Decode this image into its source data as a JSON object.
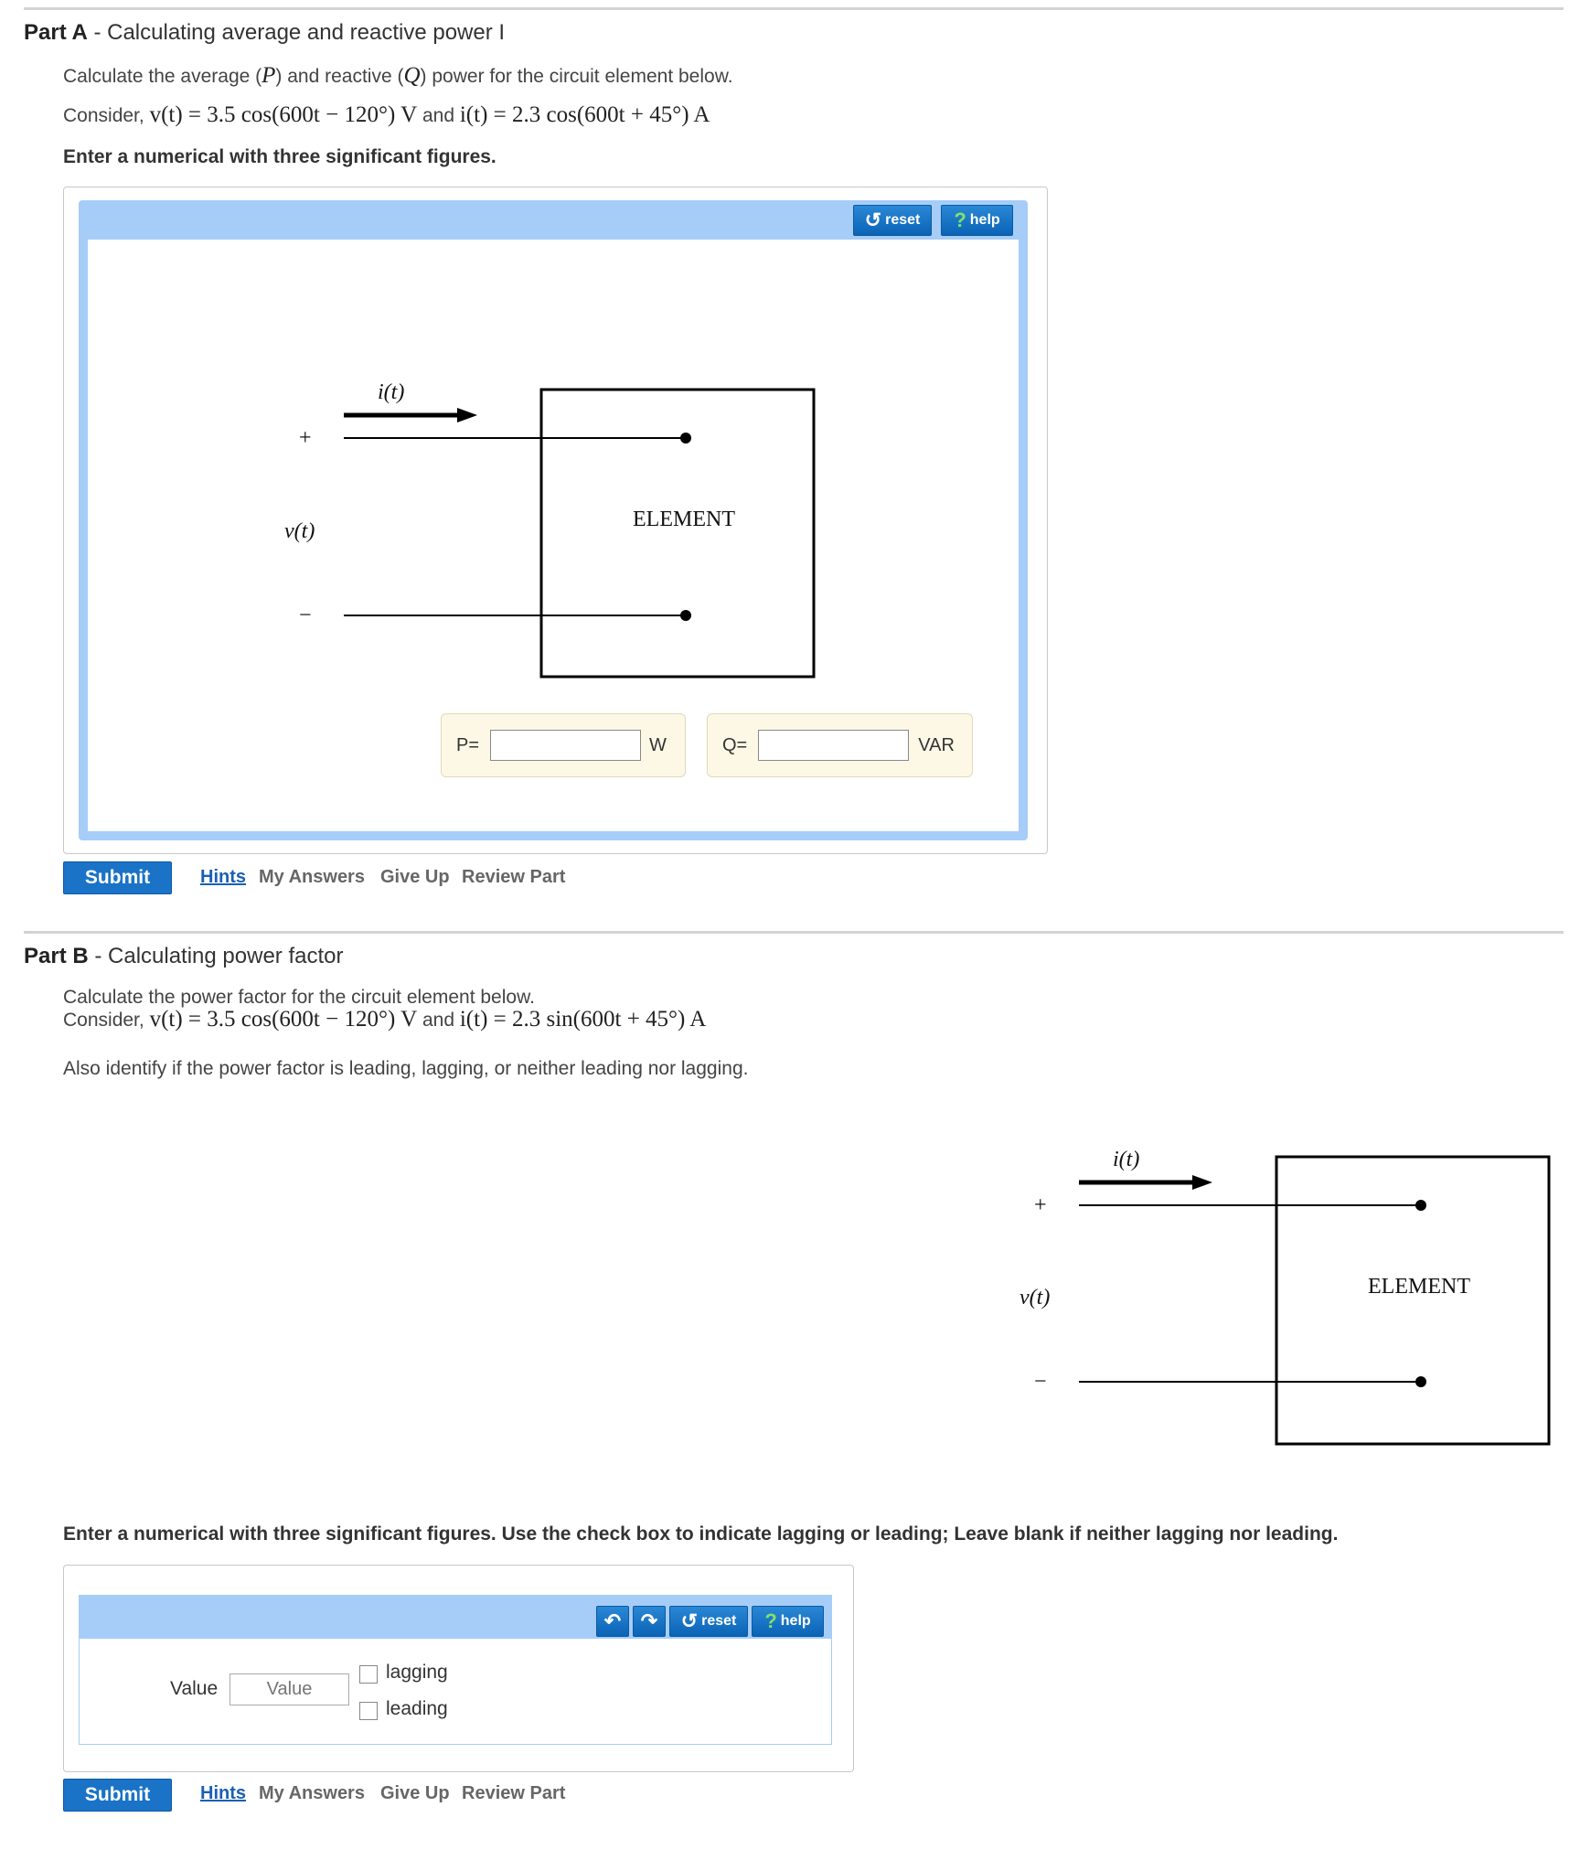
{
  "part_a": {
    "label": "Part A",
    "title": " - Calculating average and reactive power I",
    "intro_1": "Calculate the average (",
    "sym_P": "P",
    "intro_2": ") and reactive (",
    "sym_Q": "Q",
    "intro_3": ") power for the circuit element below.",
    "consider": "Consider, ",
    "v_eq": "v(t) = 3.5 cos(600t − 120°) V",
    "and": " and ",
    "i_eq": "i(t) = 2.3 cos(600t + 45°) A",
    "instruction": "Enter a numerical with three significant figures.",
    "toolbar": {
      "reset": "reset",
      "help": "help"
    },
    "diagram": {
      "current_label": "i(t)",
      "plus": "+",
      "minus": "−",
      "voltage_label": "v(t)",
      "element": "ELEMENT"
    },
    "p_prefix": "P=",
    "p_unit": "W",
    "q_prefix": "Q=",
    "q_unit": "VAR",
    "submit": "Submit",
    "links": {
      "hints": "Hints",
      "my_answers": "My Answers",
      "give_up": "Give Up",
      "review": "Review Part"
    }
  },
  "part_b": {
    "label": "Part B",
    "title": " - Calculating power factor",
    "intro": "Calculate the power factor for the circuit element below.",
    "consider": "Consider, ",
    "v_eq": "v(t) = 3.5 cos(600t − 120°) V",
    "and": " and ",
    "i_eq": "i(t) = 2.3 sin(600t + 45°) A",
    "identify": "Also identify if the power factor is leading, lagging, or neither leading nor lagging.",
    "diagram": {
      "current_label": "i(t)",
      "plus": "+",
      "minus": "−",
      "voltage_label": "v(t)",
      "element": "ELEMENT"
    },
    "instruction": "Enter a numerical with three significant figures. Use the check box to indicate lagging or leading; Leave blank if neither lagging nor leading.",
    "toolbar": {
      "reset": "reset",
      "help": "help"
    },
    "value_label": "Value",
    "value_placeholder": "Value",
    "lagging": "lagging",
    "leading": "leading",
    "submit": "Submit",
    "links": {
      "hints": "Hints",
      "my_answers": "My Answers",
      "give_up": "Give Up",
      "review": "Review Part"
    }
  },
  "colors": {
    "toolbar": "#a6cdf7",
    "frame": "#a6cdf7",
    "button": "#1a73c7",
    "answer_bg": "#fdf8e6"
  }
}
